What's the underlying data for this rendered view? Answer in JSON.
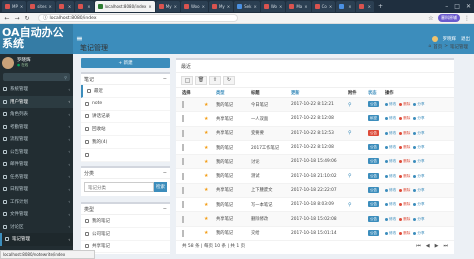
{
  "browser": {
    "tabs": [
      {
        "label": "MP",
        "active": false,
        "style": "red"
      },
      {
        "label": "sites",
        "active": false,
        "style": "red"
      },
      {
        "label": "",
        "active": false,
        "style": "red"
      },
      {
        "label": "",
        "active": false,
        "style": "red"
      },
      {
        "label": "localhost:8080/index",
        "active": true,
        "style": "green"
      },
      {
        "label": "My",
        "active": false,
        "style": "red"
      },
      {
        "label": "Woo",
        "active": false,
        "style": "red"
      },
      {
        "label": "My",
        "active": false,
        "style": "red"
      },
      {
        "label": "Sek",
        "active": false,
        "style": "alt"
      },
      {
        "label": "Wo",
        "active": false,
        "style": "red"
      },
      {
        "label": "Ma",
        "active": false,
        "style": "red"
      },
      {
        "label": "Co",
        "active": false,
        "style": "red"
      },
      {
        "label": "",
        "active": false,
        "style": "alt"
      },
      {
        "label": "",
        "active": false,
        "style": "red"
      }
    ],
    "url": "localhost:8080/index",
    "profile_label": "塞科原辅",
    "status_url": "localhost:8080/notewrite/index"
  },
  "app": {
    "logo_text": "OA自动办公系统",
    "header_user": "罗晓辉",
    "header_extra": "退出"
  },
  "sidebar": {
    "user_name": "罗晓辉",
    "user_status": "在线",
    "search_placeholder": "",
    "items": [
      {
        "label": "系统管理"
      },
      {
        "label": "用户管理",
        "state": "hl"
      },
      {
        "label": "角色列表"
      },
      {
        "label": "考勤管理"
      },
      {
        "label": "流程管理"
      },
      {
        "label": "公告管理"
      },
      {
        "label": "邮件管理"
      },
      {
        "label": "任务管理"
      },
      {
        "label": "日程管理"
      },
      {
        "label": "工作计划"
      },
      {
        "label": "文件管理"
      },
      {
        "label": "讨论区"
      },
      {
        "label": "笔记管理",
        "state": "active"
      }
    ]
  },
  "page": {
    "title": "笔记管理",
    "breadcrumb_home": "首页",
    "breadcrumb_sep": ">",
    "breadcrumb_current": "笔记管理"
  },
  "left": {
    "compose_label": "新建",
    "notes_title": "笔记",
    "notes_items": [
      {
        "label": "最近",
        "selected": true
      },
      {
        "label": "note",
        "selected": false
      },
      {
        "label": "讲话记录",
        "selected": false
      },
      {
        "label": "回收站",
        "selected": false
      },
      {
        "label": "我的(4)",
        "selected": false
      },
      {
        "label": "",
        "selected": false
      }
    ],
    "category_title": "分类",
    "search_placeholder": "笔记分类",
    "search_button": "检索",
    "type_title": "类型",
    "type_items": [
      {
        "label": "我的笔记"
      },
      {
        "label": "公司笔记"
      },
      {
        "label": "共享笔记"
      }
    ]
  },
  "main": {
    "box_title": "最近",
    "columns": [
      "选择",
      "类型",
      "标题",
      "更新",
      "附件",
      "状态",
      "操作"
    ],
    "rows": [
      {
        "type": "我的笔记",
        "title": "今日笔记",
        "date": "2017-10-22 8:12:21",
        "attach": true,
        "status": "公告",
        "status_color": "#3c8dbc"
      },
      {
        "type": "共享笔记",
        "title": "一人双面",
        "date": "2017-10-22 8:12:08",
        "attach": false,
        "status": "私密",
        "status_color": "#3c8dbc"
      },
      {
        "type": "共享笔记",
        "title": "变要要",
        "date": "2017-10-22 8:12:53",
        "attach": true,
        "status": "公告",
        "status_color": "#dd4b39"
      },
      {
        "type": "我的笔记",
        "title": "2017工作笔记",
        "date": "2017-10-22 8:12:08",
        "attach": false,
        "status": "公告",
        "status_color": "#3c8dbc"
      },
      {
        "type": "我的笔记",
        "title": "讨论",
        "date": "2017-10-18 15:49:06",
        "attach": false,
        "status": "公告",
        "status_color": "#3c8dbc"
      },
      {
        "type": "我的笔记",
        "title": "测试",
        "date": "2017-10-18 21:10:02",
        "attach": true,
        "status": "公告",
        "status_color": "#3c8dbc"
      },
      {
        "type": "共享笔记",
        "title": "上下腰废文",
        "date": "2017-10-18 22:22:07",
        "attach": false,
        "status": "公告",
        "status_color": "#3c8dbc"
      },
      {
        "type": "我的笔记",
        "title": "写一本笔记",
        "date": "2017-10-18 8:03:09",
        "attach": true,
        "status": "公告",
        "status_color": "#3c8dbc"
      },
      {
        "type": "共享笔记",
        "title": "删除修改",
        "date": "2017-10-18 15:02:08",
        "attach": false,
        "status": "公告",
        "status_color": "#3c8dbc"
      },
      {
        "type": "我的笔记",
        "title": "交给",
        "date": "2017-10-18 15:01:14",
        "attach": false,
        "status": "公告",
        "status_color": "#3c8dbc"
      }
    ],
    "op_labels": [
      "修改",
      "删除",
      "分享"
    ],
    "pager_text": "共 58 条 | 每页 10 条 | 共 1 页"
  }
}
